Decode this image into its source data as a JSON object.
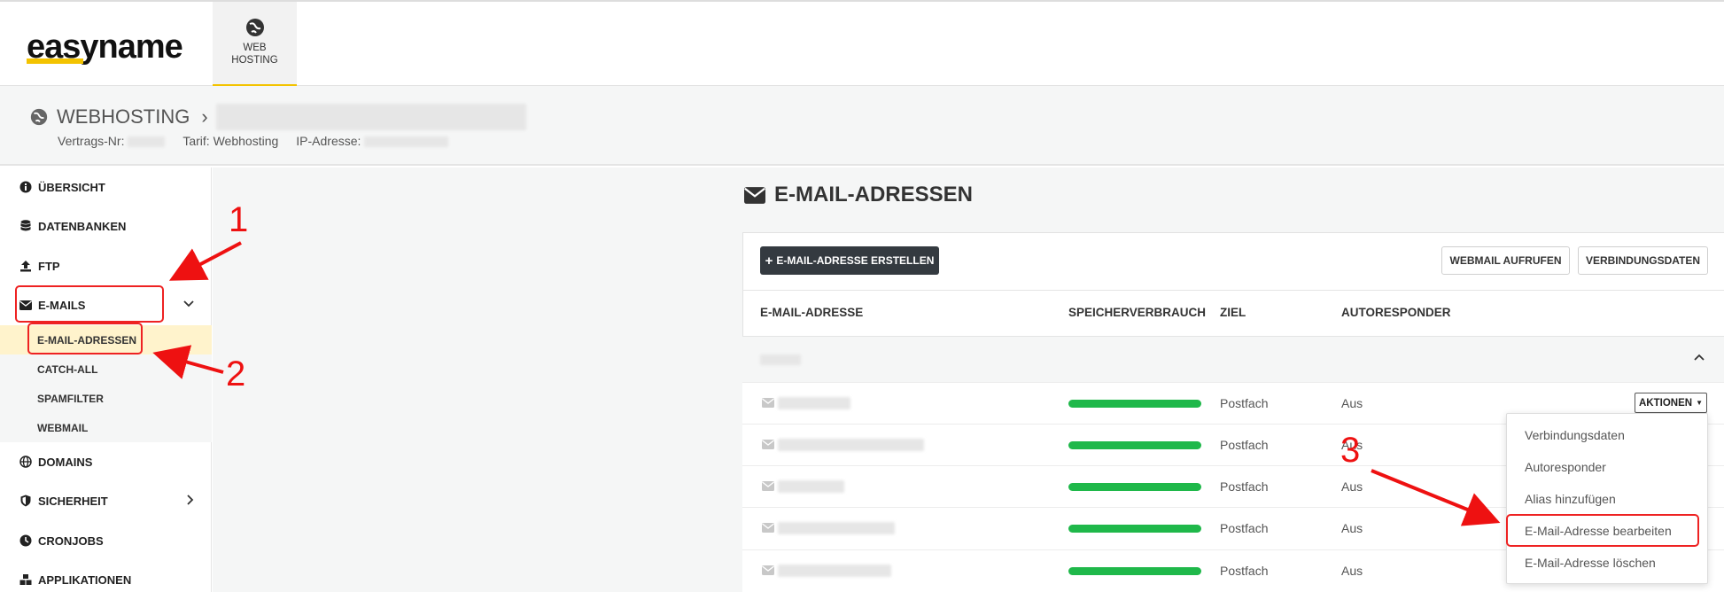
{
  "header": {
    "logo": "easyname",
    "nav_tab_label": "WEB\nHOSTING"
  },
  "subheader": {
    "title": "WEBHOSTING",
    "vertrag_label": "Vertrags-Nr:",
    "tarif_label": "Tarif: Webhosting",
    "ip_label": "IP-Adresse:"
  },
  "sidebar": {
    "items": [
      {
        "label": "ÜBERSICHT"
      },
      {
        "label": "DATENBANKEN"
      },
      {
        "label": "FTP"
      },
      {
        "label": "E-MAILS"
      },
      {
        "label": "DOMAINS"
      },
      {
        "label": "SICHERHEIT"
      },
      {
        "label": "CRONJOBS"
      },
      {
        "label": "APPLIKATIONEN"
      }
    ],
    "sub_items": [
      {
        "label": "E-MAIL-ADRESSEN"
      },
      {
        "label": "CATCH-ALL"
      },
      {
        "label": "SPAMFILTER"
      },
      {
        "label": "WEBMAIL"
      }
    ]
  },
  "main": {
    "title": "E-MAIL-ADRESSEN",
    "create_button": "E-MAIL-ADRESSE ERSTELLEN",
    "webmail_button": "WEBMAIL AUFRUFEN",
    "verbindung_button": "VERBINDUNGSDATEN",
    "columns": [
      "E-MAIL-ADRESSE",
      "SPEICHERVERBRAUCH",
      "ZIEL",
      "AUTORESPONDER"
    ],
    "rows": [
      {
        "ziel": "Postfach",
        "autoresponder": "Aus"
      },
      {
        "ziel": "Postfach",
        "autoresponder": "Aus"
      },
      {
        "ziel": "Postfach",
        "autoresponder": "Aus"
      },
      {
        "ziel": "Postfach",
        "autoresponder": "Aus"
      },
      {
        "ziel": "Postfach",
        "autoresponder": "Aus"
      }
    ],
    "aktionen_button": "AKTIONEN",
    "dropdown": [
      {
        "label": "Verbindungsdaten"
      },
      {
        "label": "Autoresponder"
      },
      {
        "label": "Alias hinzufügen"
      },
      {
        "label": "E-Mail-Adresse bearbeiten"
      },
      {
        "label": "E-Mail-Adresse löschen"
      }
    ]
  },
  "annotations": [
    "1",
    "2",
    "3"
  ],
  "colors": {
    "accent": "#f3c300",
    "usage_bar": "#1fb84a",
    "annotation": "#e22222",
    "dark_button": "#343a40"
  }
}
